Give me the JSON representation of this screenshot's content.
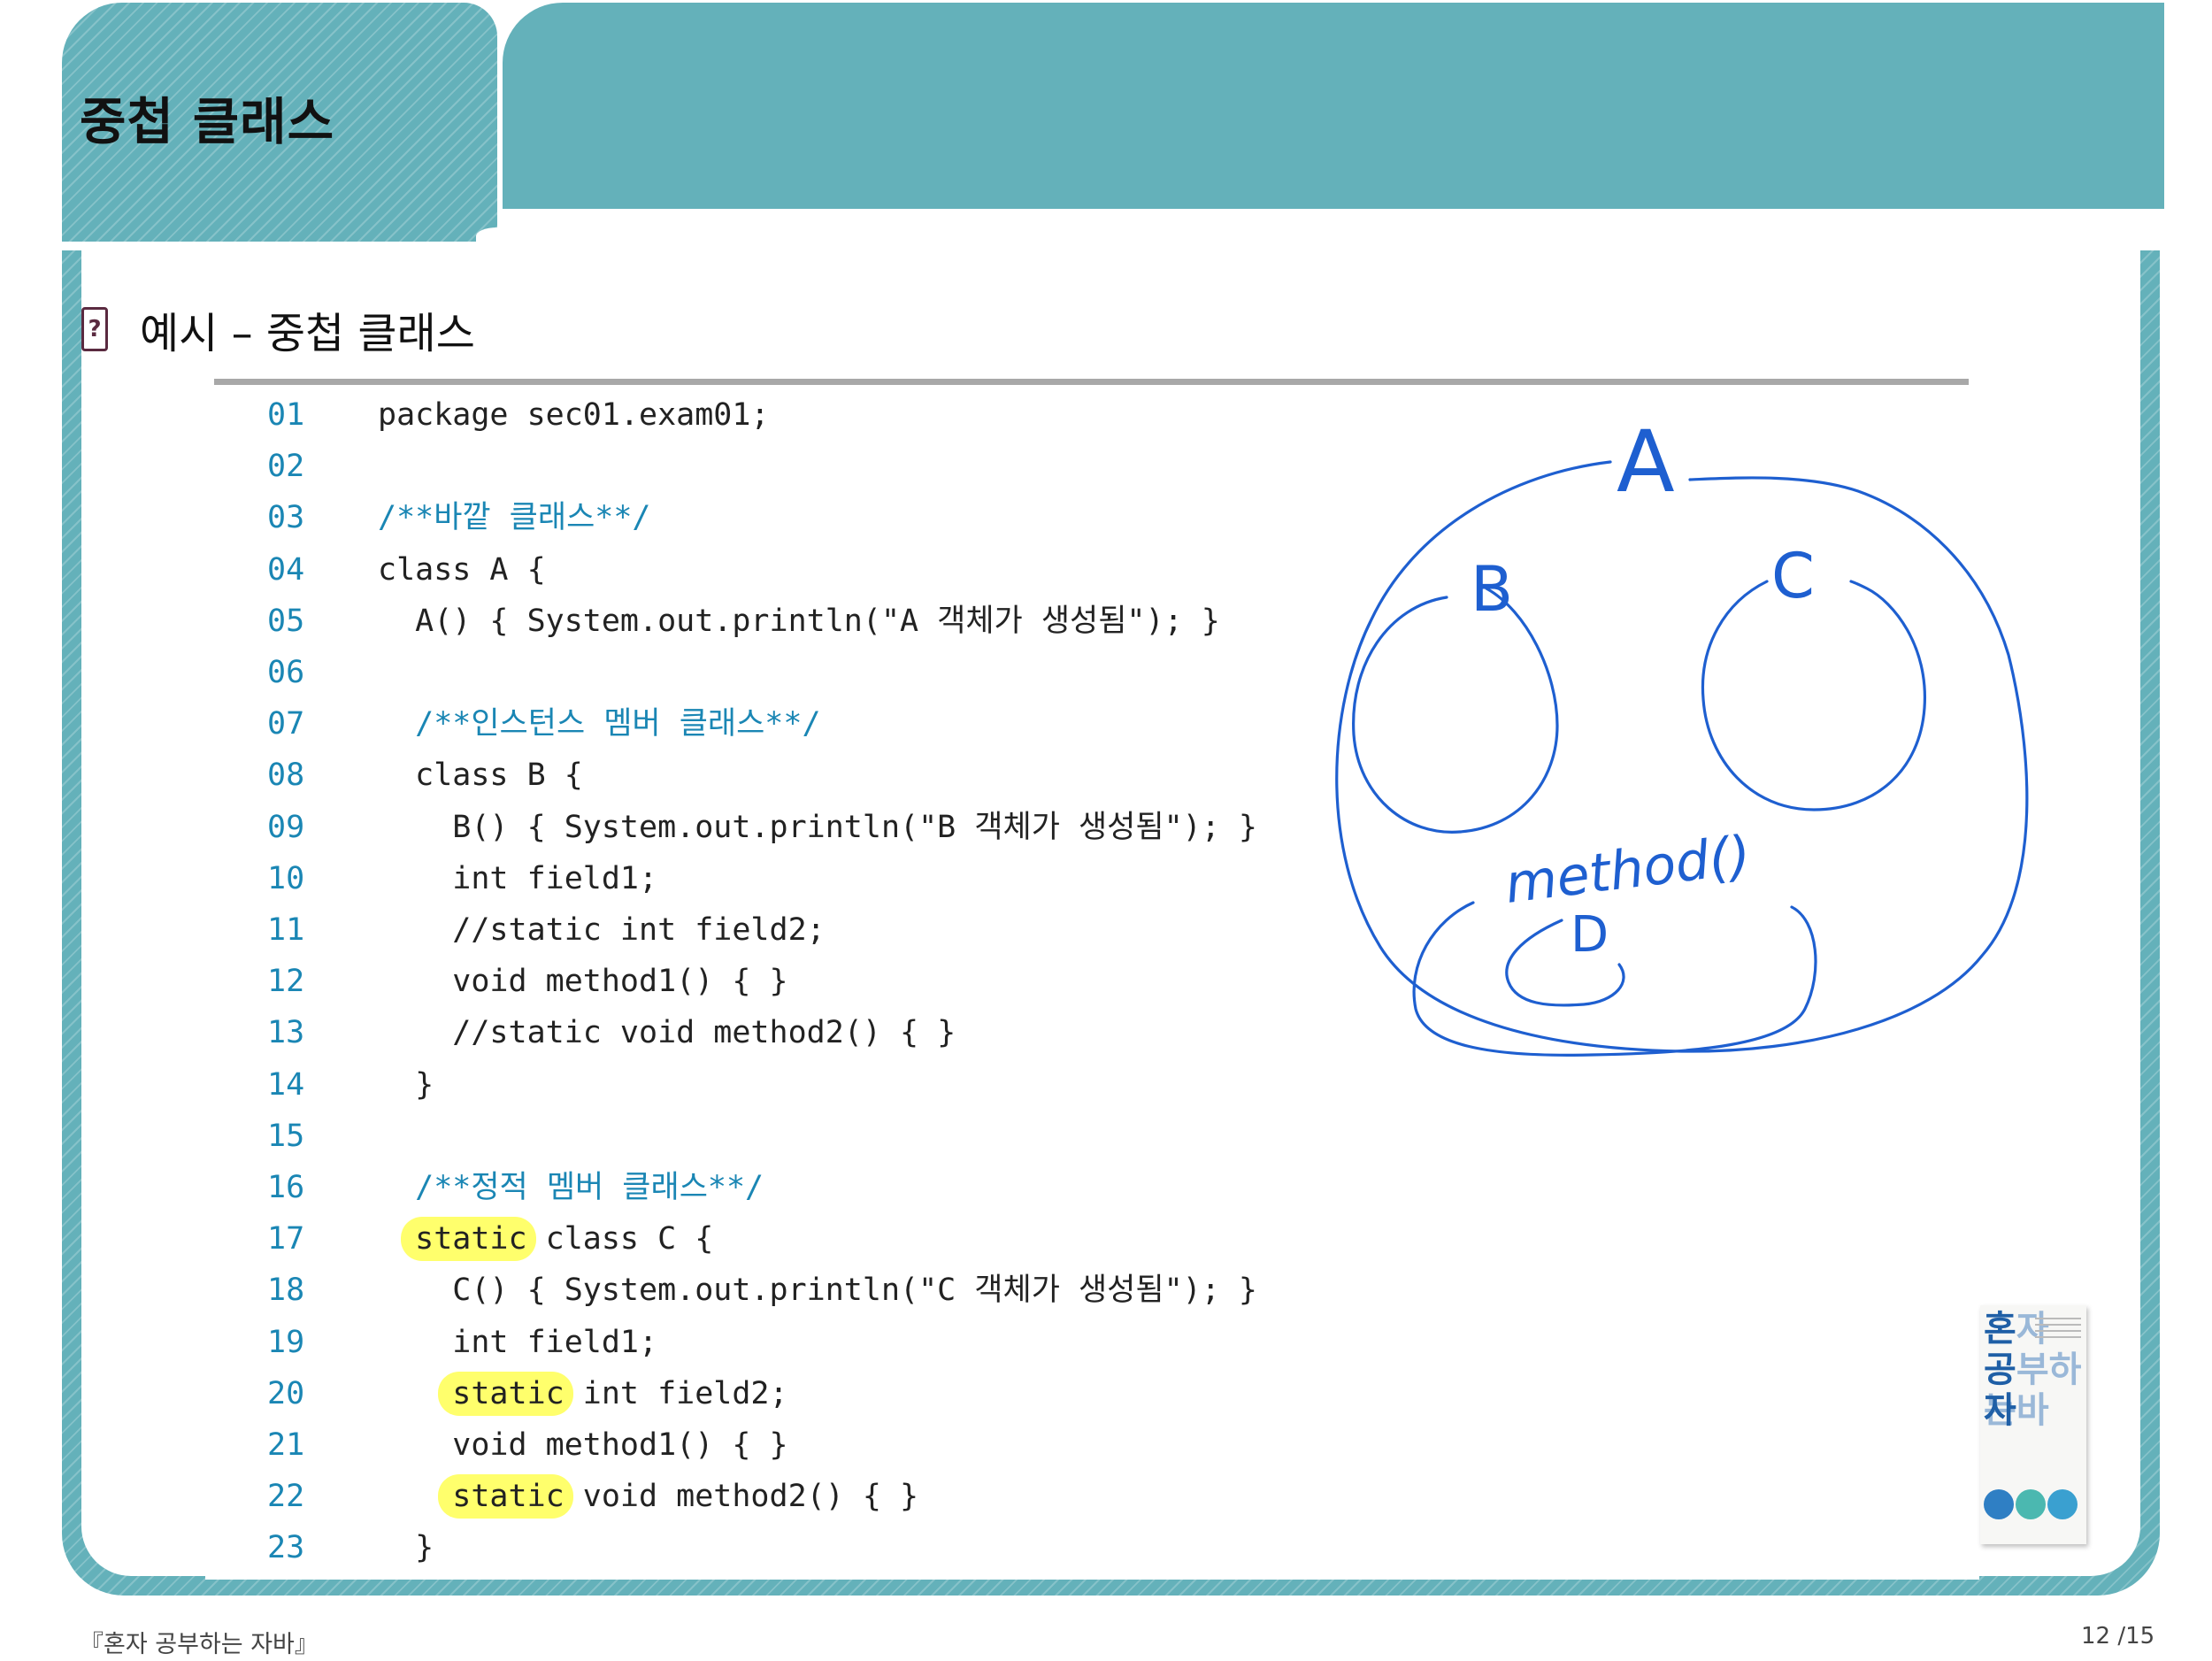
{
  "header": {
    "title": "중첩 클래스"
  },
  "section": {
    "icon": "question-box-icon",
    "icon_glyph": "?",
    "heading": "예시 – 중첩 클래스"
  },
  "code": {
    "lines": [
      {
        "num": "01",
        "text": "package sec01.exam01;",
        "kind": "code",
        "highlight": ""
      },
      {
        "num": "02",
        "text": "",
        "kind": "code",
        "highlight": ""
      },
      {
        "num": "03",
        "text": "/**바깥 클래스**/",
        "kind": "comment",
        "highlight": ""
      },
      {
        "num": "04",
        "text": "class A {",
        "kind": "code",
        "highlight": ""
      },
      {
        "num": "05",
        "text": "  A() { System.out.println(\"A 객체가 생성됨\"); }",
        "kind": "code",
        "highlight": ""
      },
      {
        "num": "06",
        "text": "",
        "kind": "code",
        "highlight": ""
      },
      {
        "num": "07",
        "text": "  /**인스턴스 멤버 클래스**/",
        "kind": "comment",
        "highlight": ""
      },
      {
        "num": "08",
        "text": "  class B {",
        "kind": "code",
        "highlight": ""
      },
      {
        "num": "09",
        "text": "    B() { System.out.println(\"B 객체가 생성됨\"); }",
        "kind": "code",
        "highlight": ""
      },
      {
        "num": "10",
        "text": "    int field1;",
        "kind": "code",
        "highlight": ""
      },
      {
        "num": "11",
        "text": "    //static int field2;",
        "kind": "code",
        "highlight": ""
      },
      {
        "num": "12",
        "text": "    void method1() { }",
        "kind": "code",
        "highlight": ""
      },
      {
        "num": "13",
        "text": "    //static void method2() { }",
        "kind": "code",
        "highlight": ""
      },
      {
        "num": "14",
        "text": "  }",
        "kind": "code",
        "highlight": ""
      },
      {
        "num": "15",
        "text": "",
        "kind": "code",
        "highlight": ""
      },
      {
        "num": "16",
        "text": "  /**정적 멤버 클래스**/",
        "kind": "comment",
        "highlight": ""
      },
      {
        "num": "17",
        "text": "  static class C {",
        "kind": "code",
        "highlight": "static"
      },
      {
        "num": "18",
        "text": "    C() { System.out.println(\"C 객체가 생성됨\"); }",
        "kind": "code",
        "highlight": ""
      },
      {
        "num": "19",
        "text": "    int field1;",
        "kind": "code",
        "highlight": ""
      },
      {
        "num": "20",
        "text": "    static int field2;",
        "kind": "code",
        "highlight": "static"
      },
      {
        "num": "21",
        "text": "    void method1() { }",
        "kind": "code",
        "highlight": ""
      },
      {
        "num": "22",
        "text": "    static void method2() { }",
        "kind": "code",
        "highlight": "static"
      },
      {
        "num": "23",
        "text": "  }",
        "kind": "code",
        "highlight": ""
      }
    ]
  },
  "annotation": {
    "label_a": "A",
    "label_b": "B",
    "label_c": "C",
    "label_method": "method()",
    "label_d": "D",
    "ink_color": "#1e5fd0"
  },
  "book_cover": {
    "row1_strong": "혼",
    "row1_light": "자",
    "row2_strong": "공",
    "row2_light": "부하는",
    "row3_strong": "자",
    "row3_light": "바"
  },
  "footer": {
    "book_title": "『혼자 공부하는 자바』",
    "page": "12 /15"
  },
  "colors": {
    "header_teal": "#64b1ba",
    "line_number": "#1a86b4",
    "comment": "#1a86b4",
    "highlighter": "#ffff33"
  }
}
